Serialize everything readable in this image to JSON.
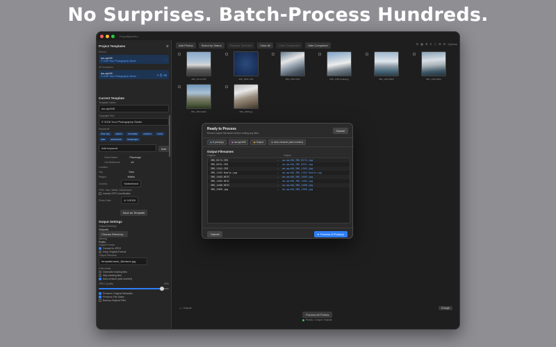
{
  "headline": "No Surprises. Batch-Process Hundreds.",
  "window": {
    "app_title": "PhotoBatchPro"
  },
  "sidebar": {
    "project_templates_title": "Project Templates",
    "recent_label": "Recent",
    "templates": [
      {
        "name": "aw-apr08",
        "detail": "© 2026 Your Photography Studio"
      },
      {
        "name": "aw-apr08",
        "detail": "© 2026 Your Photography Studio"
      }
    ],
    "all_templates_label": "All Templates",
    "current_template_title": "Current Template",
    "template_name_label": "Template Name",
    "template_name_value": "aw-apr008",
    "copyright_label": "Copyright Text",
    "copyright_value": "© 2026 Your Photography Studio",
    "keywords_label": "Keywords",
    "keywords": [
      "blue sky",
      "nature",
      "mountain",
      "outdoor",
      "snow",
      "lake",
      "adventure",
      "landscape"
    ],
    "add_keyword_placeholder": "Add keyword",
    "add_label": "Add",
    "client_name_label": "Client Name",
    "client_name_value": "Placeage",
    "job_reference_label": "Job Reference",
    "job_reference_value": "#1",
    "location_label": "Location",
    "city_label": "City",
    "city_value": "Vian",
    "region_label": "Region",
    "region_value": "Wallis",
    "country_label": "Country",
    "country_value": "Switzerland",
    "auto_fill_note": "GPS: Vian, Wallis, Switzerland",
    "use_gps_label": "Include GPS Coordinates",
    "date_label": "Photo Date",
    "date_value": "4/ 1/2026",
    "save_template_label": "Save as Template",
    "output_settings_title": "Output Settings",
    "output_directory_label": "Output Directory",
    "output_directory_value": "Outputs",
    "choose_directory_label": "Choose Directory...",
    "naming_label": "Naming",
    "naming_value": "Prefix",
    "output_format_label": "Output Format",
    "format_options": [
      "Convert to JPEG",
      "Keep Original Format"
    ],
    "output_filename_label": "Output Filename",
    "filename_pattern_value": "templatename_filename.jpg",
    "if_file_exists_label": "If file exists",
    "exists_options": [
      "Overwrite existing files",
      "Skip existing files",
      "Auto-rename (add number)"
    ],
    "jpeg_quality_label": "JPEG Quality",
    "jpeg_quality_value": "90%",
    "jpeg_quality": 0.9,
    "bottom_options": [
      "Preserve Original Metadata",
      "Preserve File Dates",
      "Backup Original Files"
    ]
  },
  "toolbar": {
    "add_photos": "Add Photos",
    "select_by_status": "Select by Status",
    "remove_selected": "Remove Selected",
    "clear_all": "Clear All",
    "clear_completed": "Clear Completed",
    "hide_completed": "Hide Completed",
    "view_icons": [
      "list-view-icon",
      "grid-view-icon",
      "sort-icon",
      "filter-icon",
      "info-icon",
      "zoom-icon",
      "gear-icon"
    ],
    "options_label": "Options"
  },
  "photos": [
    {
      "name": "IMG_8174.CR3"
    },
    {
      "name": "IMG_8301.CR3"
    },
    {
      "name": "IMG_1161.CR3"
    },
    {
      "name": "IMG_1163 Koala.jpg"
    },
    {
      "name": "IMG_1403.HEIC"
    },
    {
      "name": "IMG_1403.HEIC"
    },
    {
      "name": "IMG_1804.HEIC"
    },
    {
      "name": "IMG_2969.jpg"
    }
  ],
  "dialog": {
    "title": "Ready to Process",
    "subtitle": "Review output filenames before writing any files.",
    "cancel_top": "Cancel",
    "chips": [
      {
        "icon": "photo-icon",
        "label": "8 photo(s)"
      },
      {
        "icon": "template-icon",
        "label": "aw-apr008"
      },
      {
        "icon": "folder-icon",
        "label": "Output"
      },
      {
        "icon": "rename-icon",
        "label": "Auto-rename (add number)"
      }
    ],
    "output_filenames_title": "Output Filenames",
    "col_original": "Original",
    "col_output": "Output",
    "rows": [
      {
        "original": "IMG_8174.CR3",
        "output": "aw-apr08_IMG_8174.jpg"
      },
      {
        "original": "IMG_8331.CR3",
        "output": "aw-apr08_IMG_8331.jpg"
      },
      {
        "original": "IMG_1161.CR3",
        "output": "aw-apr08_IMG_1161.jpg"
      },
      {
        "original": "IMG_1163 Koala.jpg",
        "output": "aw-apr08_IMG_1163 Koala.jpg"
      },
      {
        "original": "IMG_1403.HEIC",
        "output": "aw-apr08_IMG_1403.jpg"
      },
      {
        "original": "IMG_1483.HEIC",
        "output": "aw-apr08_IMG_1483.jpg"
      },
      {
        "original": "IMG_1486.HEIC",
        "output": "aw-apr08_IMG_1486.jpg"
      },
      {
        "original": "IMG_2969.jpg",
        "output": "aw-apr08_IMG_2969.jpg"
      }
    ],
    "cancel_bottom": "Cancel",
    "process_button": "Process 8 Photo(s)"
  },
  "footer": {
    "output_path_label": "Outputs",
    "change_label": "Change",
    "process_all_label": "Process All Photos",
    "status_text": "Ready • Output: Outputs"
  },
  "colors": {
    "accent": "#2d7ff9",
    "window_bg": "#1e1e1e",
    "backdrop": "#8e8e93"
  }
}
